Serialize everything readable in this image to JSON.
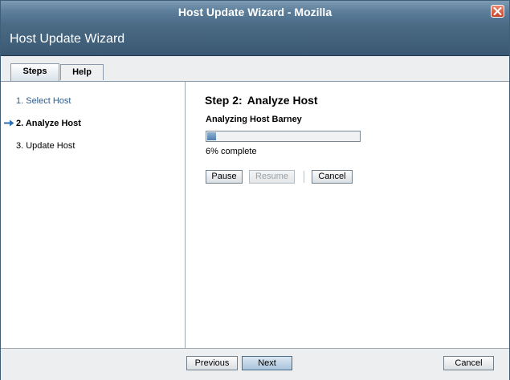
{
  "window": {
    "title": "Host Update Wizard - Mozilla"
  },
  "header": {
    "title": "Host Update Wizard"
  },
  "tabs": [
    {
      "label": "Steps",
      "active": true
    },
    {
      "label": "Help",
      "active": false
    }
  ],
  "steps": [
    {
      "label": "1. Select Host",
      "state": "link"
    },
    {
      "label": "2. Analyze Host",
      "state": "current"
    },
    {
      "label": "3. Update Host",
      "state": "pending"
    }
  ],
  "content": {
    "step_label": "Step 2:",
    "step_title": "Analyze Host",
    "status": "Analyzing Host Barney",
    "progress_fraction": 0.06,
    "progress_text": "6% complete",
    "pause_label": "Pause",
    "resume_label": "Resume",
    "cancel_label": "Cancel"
  },
  "footer": {
    "previous_label": "Previous",
    "next_label": "Next",
    "cancel_label": "Cancel"
  },
  "icons": {
    "close": "close-icon",
    "current_step": "arrow-right-icon"
  },
  "colors": {
    "titlebar": "#5d7f9b",
    "header": "#3f5e79",
    "link": "#2d5a8c",
    "progress": "#4f7fae",
    "arrow": "#2d6fb5"
  }
}
